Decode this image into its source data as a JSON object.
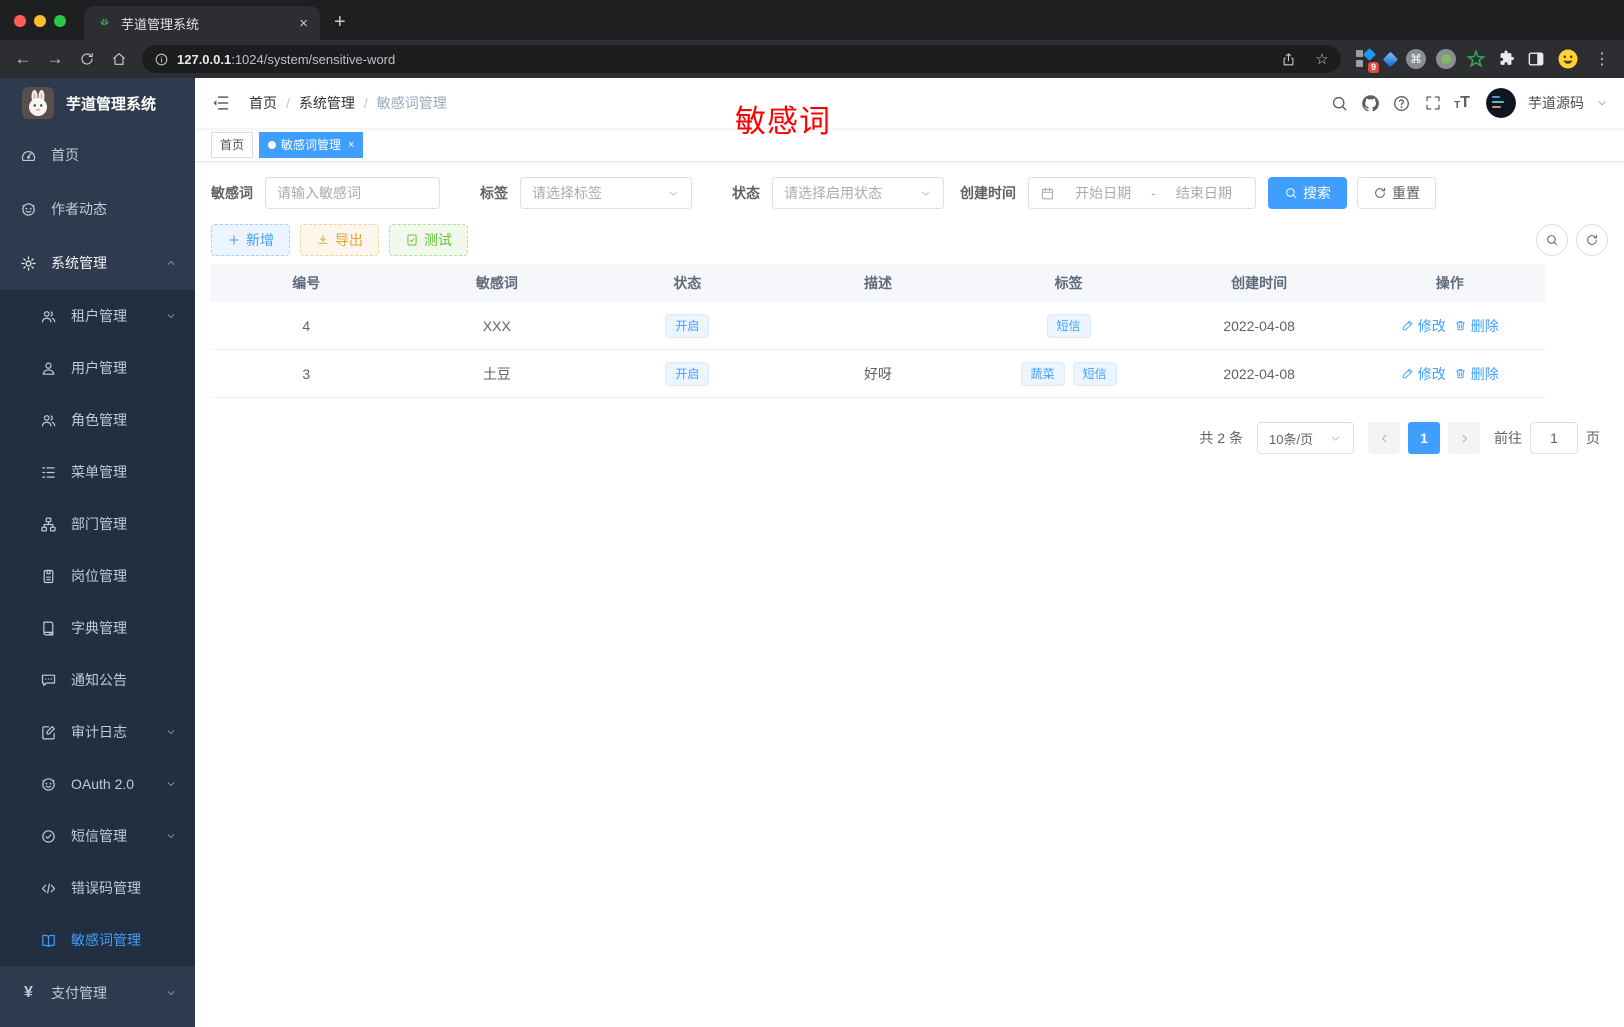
{
  "browser": {
    "tab_title": "芋道管理系统",
    "tab_close_glyph": "×",
    "new_tab_glyph": "+",
    "back_glyph": "←",
    "forward_glyph": "→",
    "url_host": "127.0.0.1",
    "url_path": ":1024/system/sensitive-word",
    "star_glyph": "☆",
    "extension_badge": "9",
    "cmd_glyph": "⌘",
    "kebab_glyph": "⋮"
  },
  "sidebar": {
    "logo_title": "芋道管理系统",
    "top_items": [
      {
        "label": "首页"
      },
      {
        "label": "作者动态"
      },
      {
        "label": "系统管理"
      }
    ],
    "sub_items": [
      {
        "label": "租户管理"
      },
      {
        "label": "用户管理"
      },
      {
        "label": "角色管理"
      },
      {
        "label": "菜单管理"
      },
      {
        "label": "部门管理"
      },
      {
        "label": "岗位管理"
      },
      {
        "label": "字典管理"
      },
      {
        "label": "通知公告"
      },
      {
        "label": "审计日志"
      },
      {
        "label": "OAuth 2.0"
      },
      {
        "label": "短信管理"
      },
      {
        "label": "错误码管理"
      },
      {
        "label": "敏感词管理"
      }
    ],
    "bottom_items": [
      {
        "label": "支付管理"
      }
    ],
    "yen_glyph": "¥"
  },
  "header": {
    "breadcrumb": [
      "首页",
      "系统管理",
      "敏感词管理"
    ],
    "breadcrumb_separator": "/",
    "overlay_text": "敏感词",
    "username": "芋道源码"
  },
  "tags_view": {
    "tabs": [
      {
        "label": "首页"
      },
      {
        "label": "敏感词管理"
      }
    ],
    "close_glyph": "×"
  },
  "filters": {
    "keyword_label": "敏感词",
    "keyword_placeholder": "请输入敏感词",
    "tag_label": "标签",
    "tag_placeholder": "请选择标签",
    "status_label": "状态",
    "status_placeholder": "请选择启用状态",
    "time_label": "创建时间",
    "start_placeholder": "开始日期",
    "range_separator": "-",
    "end_placeholder": "结束日期",
    "search_label": "搜索",
    "reset_label": "重置"
  },
  "toolbar": {
    "add_label": "新增",
    "export_label": "导出",
    "test_label": "测试"
  },
  "table": {
    "columns": [
      "编号",
      "敏感词",
      "状态",
      "描述",
      "标签",
      "创建时间",
      "操作"
    ],
    "edit_label": "修改",
    "delete_label": "删除",
    "rows": [
      {
        "id": "4",
        "word": "XXX",
        "status": "开启",
        "description": "",
        "tags": [
          "短信"
        ],
        "create_time": "2022-04-08"
      },
      {
        "id": "3",
        "word": "土豆",
        "status": "开启",
        "description": "好呀",
        "tags": [
          "蔬菜",
          "短信"
        ],
        "create_time": "2022-04-08"
      }
    ]
  },
  "pagination": {
    "total_text": "共 2 条",
    "page_size": "10条/页",
    "current_page": "1",
    "goto_label": "前往",
    "goto_value": "1",
    "page_unit": "页"
  },
  "colors": {
    "primary": "#409eff",
    "warning": "#e6a23c",
    "success": "#67c23a",
    "overlay_red": "#fe0000",
    "sidebar_bg": "#2e3b4e",
    "submenu_bg": "#212f41",
    "active_tag_bg": "#409eff"
  }
}
